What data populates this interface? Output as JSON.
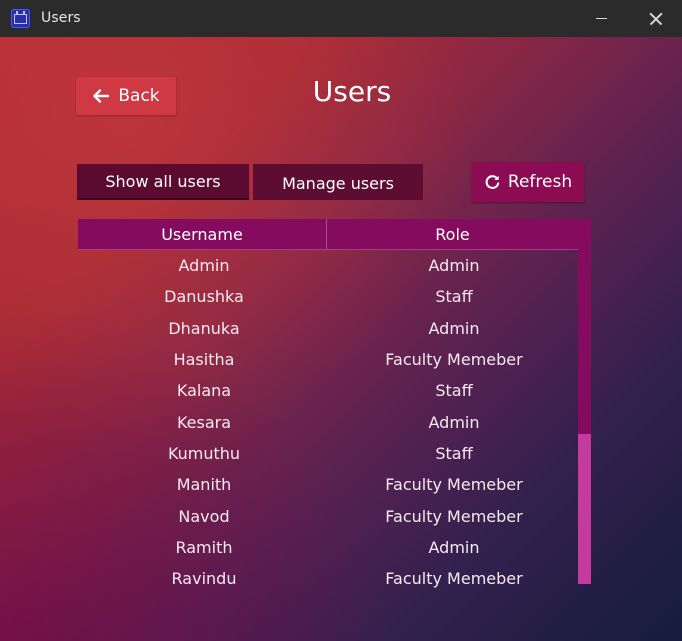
{
  "window": {
    "title": "Users"
  },
  "header": {
    "back_label": "Back",
    "page_title": "Users"
  },
  "actions": {
    "show_all_label": "Show all users",
    "manage_label": "Manage users",
    "refresh_label": "Refresh"
  },
  "table": {
    "columns": [
      "Username",
      "Role"
    ],
    "rows": [
      {
        "username": "Admin",
        "role": "Admin"
      },
      {
        "username": "Danushka",
        "role": "Staff"
      },
      {
        "username": "Dhanuka",
        "role": "Admin"
      },
      {
        "username": "Hasitha",
        "role": "Faculty Memeber"
      },
      {
        "username": "Kalana",
        "role": "Staff"
      },
      {
        "username": "Kesara",
        "role": "Admin"
      },
      {
        "username": "Kumuthu",
        "role": "Staff"
      },
      {
        "username": "Manith",
        "role": "Faculty Memeber"
      },
      {
        "username": "Navod",
        "role": "Faculty Memeber"
      },
      {
        "username": "Ramith",
        "role": "Admin"
      },
      {
        "username": "Ravindu",
        "role": "Faculty Memeber"
      }
    ]
  },
  "icons": {
    "app": "calendar-icon",
    "back": "arrow-left-icon",
    "refresh": "refresh-icon",
    "minimize": "minimize-icon",
    "close": "close-icon"
  },
  "colors": {
    "accent": "#840b5d",
    "back_button": "#ce3943",
    "scroll_thumb": "#c53a9d"
  }
}
